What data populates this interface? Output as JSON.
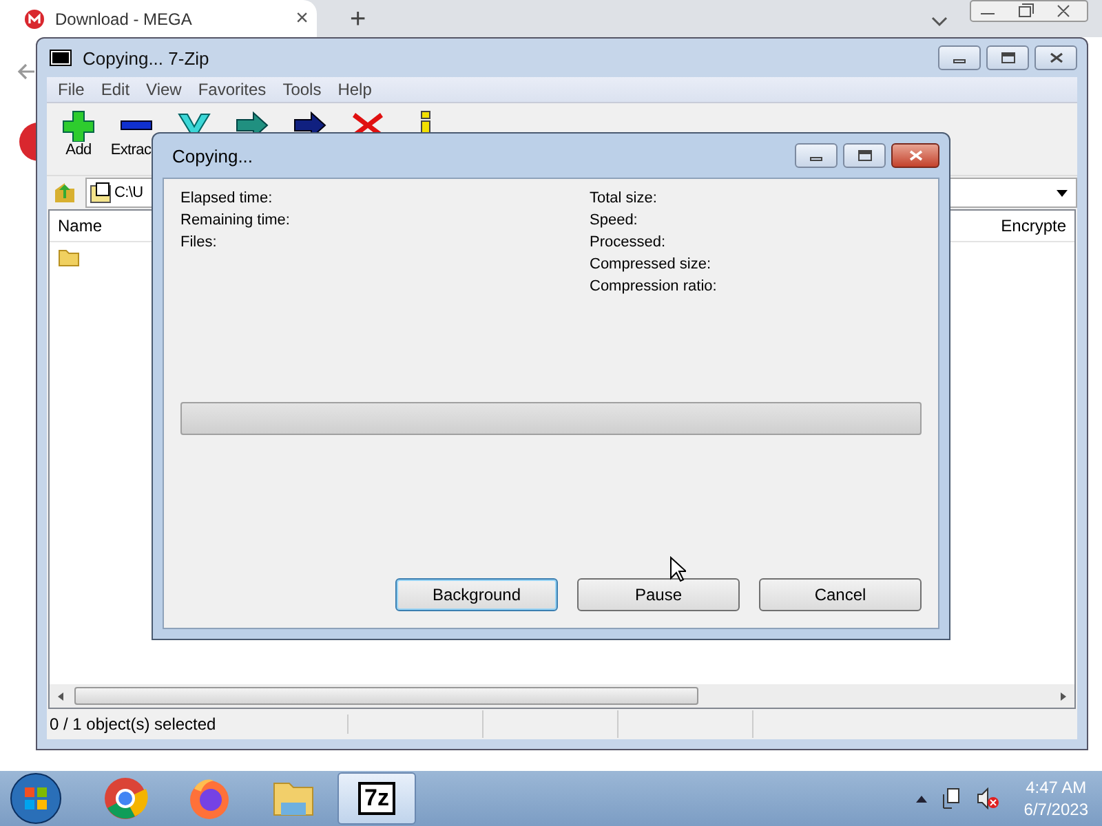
{
  "browser": {
    "tab_title": "Download - MEGA",
    "tab_close": "×",
    "new_tab": "+"
  },
  "main_window": {
    "title": "Copying... 7-Zip",
    "menu": [
      "File",
      "Edit",
      "View",
      "Favorites",
      "Tools",
      "Help"
    ],
    "toolbar": [
      {
        "kind": "add",
        "label": "Add"
      },
      {
        "kind": "extract",
        "label": "Extrac"
      },
      {
        "kind": "test"
      },
      {
        "kind": "copy"
      },
      {
        "kind": "move"
      },
      {
        "kind": "delete"
      },
      {
        "kind": "info"
      }
    ],
    "path": "C:\\U",
    "columns": [
      "Name",
      "Encrypte"
    ],
    "status_bar": "0 / 1 object(s) selected"
  },
  "dialog": {
    "title": "Copying...",
    "left_fields": [
      "Elapsed time:",
      "Remaining time:",
      "Files:"
    ],
    "right_fields": [
      "Total size:",
      "Speed:",
      "Processed:",
      "Compressed size:",
      "Compression ratio:"
    ],
    "progress": {
      "level": 0
    },
    "buttons": [
      {
        "label": "Background",
        "focused": true
      },
      {
        "label": "Pause",
        "focused": false
      },
      {
        "label": "Cancel",
        "focused": false
      }
    ]
  },
  "taskbar": {
    "apps": [
      {
        "kind": "chrome",
        "selected": false
      },
      {
        "kind": "firefox",
        "selected": false
      },
      {
        "kind": "explorer",
        "selected": false
      },
      {
        "kind": "sevenzip",
        "selected": true,
        "label": "7z"
      }
    ],
    "time": "4:47 AM",
    "date": "6/7/2023"
  }
}
